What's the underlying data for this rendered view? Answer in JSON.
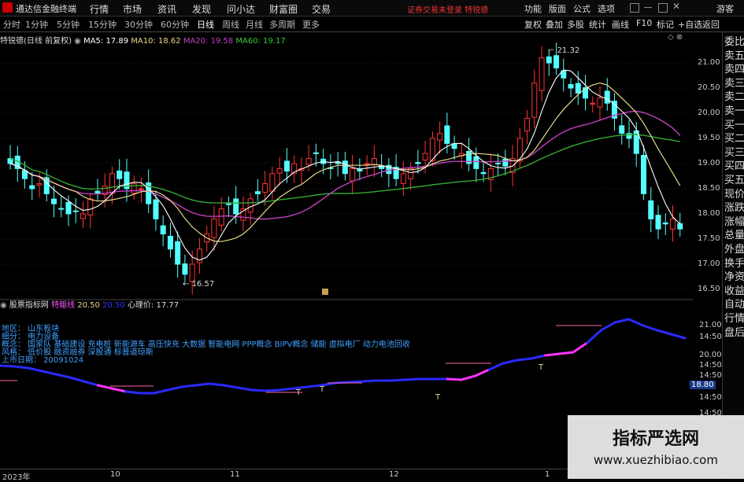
{
  "titlebar": {
    "app_name": "通达信金融终端",
    "menus": [
      "行情",
      "市场",
      "资讯",
      "发现",
      "问小达",
      "财富圈",
      "交易"
    ],
    "notice": "证券交易未登录 特锐德",
    "right_menus": [
      "功能",
      "版面",
      "公式",
      "选项"
    ],
    "account": "游客"
  },
  "toolbar": {
    "periods": [
      "分时",
      "1分钟",
      "5分钟",
      "15分钟",
      "30分钟",
      "60分钟",
      "日线",
      "周线",
      "月线",
      "多周期",
      "更多"
    ],
    "active_period": "日线",
    "buttons": [
      "复权",
      "叠加",
      "多股",
      "统计",
      "画线",
      "F10",
      "标记",
      "+自选",
      "返回"
    ]
  },
  "legend": {
    "stock": "特锐德(日线 前复权)",
    "ma5": "MA5: 17.89",
    "ma10": "MA10: 18.62",
    "ma20": "MA20: 19.58",
    "ma60": "MA60: 19.17"
  },
  "colors": {
    "up": "#ff3333",
    "down": "#54ffff",
    "ma5": "#ffffff",
    "ma10": "#e6d88a",
    "ma20": "#c040c0",
    "ma60": "#33aa33",
    "indicator_blue": "#2a2aff",
    "indicator_magenta": "#ff33ff"
  },
  "price_axis": [
    "21.00",
    "20.50",
    "20.00",
    "19.50",
    "19.00",
    "18.50",
    "18.00",
    "17.50",
    "17.00",
    "16.50"
  ],
  "annotations": {
    "high": "21.32",
    "low": "16.57"
  },
  "lower": {
    "title": "股票指标网",
    "name": "特躯线",
    "val1": "20.50",
    "val2": "20.50",
    "psych": "心理价: 17.77",
    "axis": [
      "21.00",
      "20.00",
      "14:50",
      "14:50",
      "14:50",
      "14:50",
      "14:50"
    ],
    "current": "18.80",
    "info": [
      "地区：  山东板块",
      "细分：  电力设备",
      "概念：  国家队 基础建设 充电桩 新能源车 高压快充 大数据 智能电网 PPP概念 BIPV概念 储能 虚拟电厂 动力电池回收",
      "风格：  低价股 融资融券 深股通 标普道琼斯",
      "上市日期： 20091024"
    ],
    "markers": [
      "T",
      "T",
      "T",
      "T"
    ]
  },
  "right_panel": [
    "委比",
    "卖五",
    "卖四",
    "卖三",
    "卖二",
    "卖一",
    "买一",
    "买二",
    "买三",
    "买四",
    "买五",
    "现价",
    "涨跌",
    "涨幅",
    "总量",
    "外盘",
    "换手",
    "净资",
    "收益",
    "自动",
    "行情",
    "盘后"
  ],
  "x_axis": [
    "2023年",
    "10",
    "11",
    "12",
    "1"
  ],
  "watermark": {
    "title": "指标严选网",
    "url": "www.xuezhibiao.com"
  }
}
